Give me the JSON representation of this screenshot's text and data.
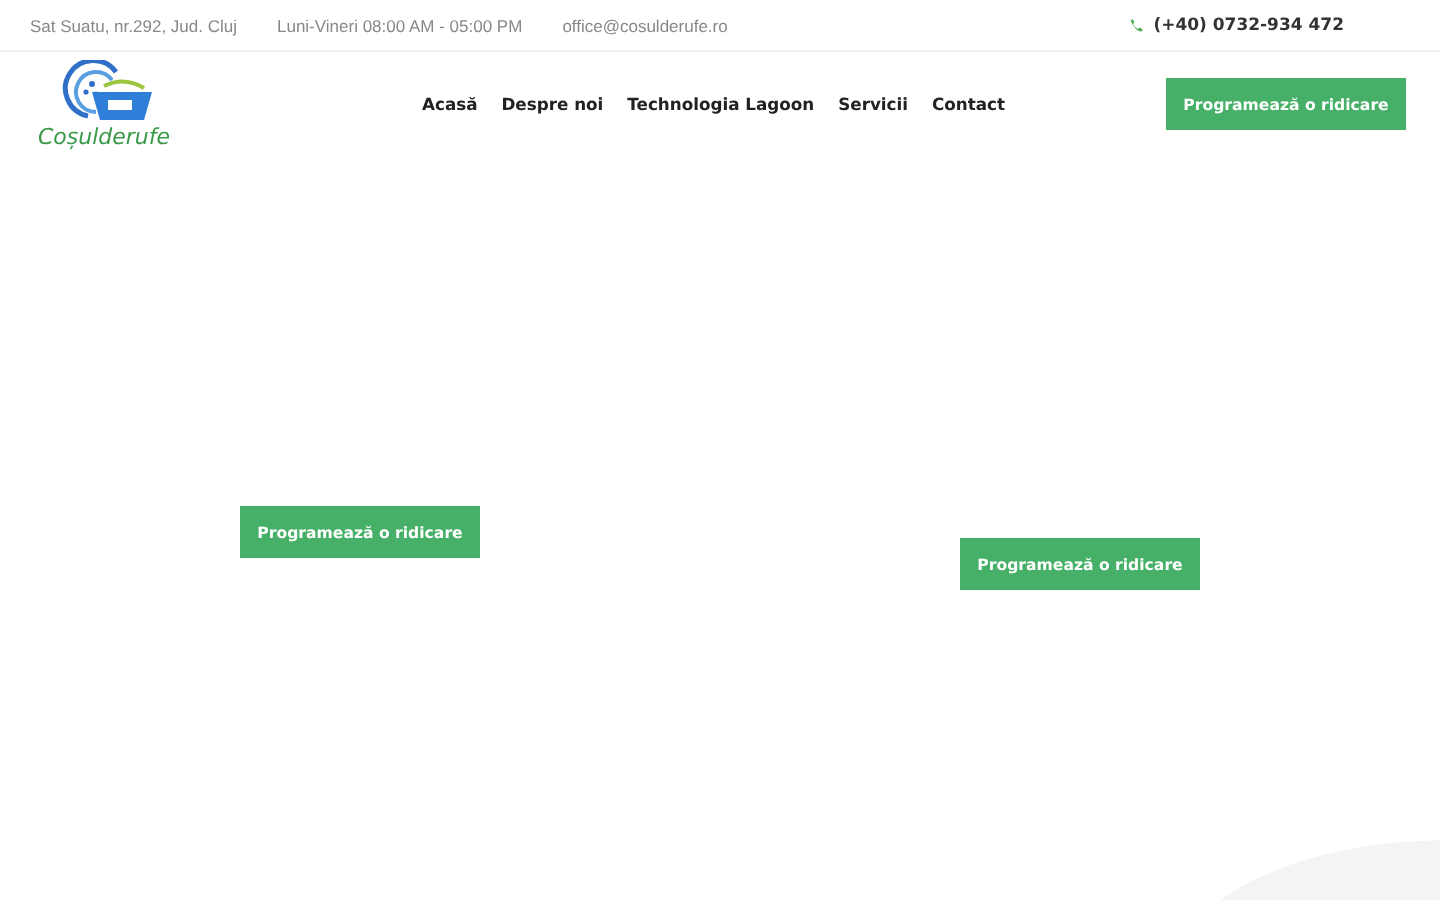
{
  "top_bar": {
    "address": "Sat Suatu, nr.292, Jud. Cluj",
    "hours": "Luni-Vineri 08:00 AM - 05:00 PM",
    "email": "office@cosulderufe.ro",
    "phone": "(+40) 0732-934 472"
  },
  "header": {
    "logo_text": "Coșulderufe",
    "nav": [
      {
        "label": "Acasă"
      },
      {
        "label": "Despre noi"
      },
      {
        "label": "Technologia Lagoon"
      },
      {
        "label": "Servicii"
      },
      {
        "label": "Contact"
      }
    ],
    "cta": "Programează o ridicare"
  },
  "hero": {
    "buttons": [
      "Programează o ridicare",
      "Programează o ridicare"
    ]
  }
}
